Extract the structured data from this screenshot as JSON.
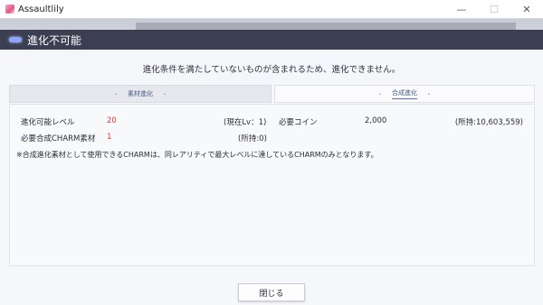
{
  "window": {
    "title": "Assaultlily",
    "minimize_glyph": "—",
    "maximize_glyph": "☐",
    "close_glyph": "✕"
  },
  "dialog": {
    "title": "進化不可能",
    "message": "進化条件を満たしていないものが含まれるため、進化できません。",
    "tabs": [
      {
        "label": "素材進化",
        "active": false
      },
      {
        "label": "合成進化",
        "active": true
      }
    ],
    "tab_dot": "・",
    "info": {
      "level_label": "進化可能レベル",
      "level_value": "20",
      "current_level": "(現在Lv：1)",
      "coin_label": "必要コイン",
      "coin_value": "2,000",
      "coin_owned": "(所持:10,603,559)",
      "charm_label": "必要合成CHARM素材",
      "charm_value": "1",
      "charm_owned": "(所持:0)"
    },
    "note": "※合成進化素材として使用できるCHARMは、同レアリティで最大レベルに達しているCHARMのみとなります。",
    "close_button": "閉じる"
  },
  "colors": {
    "header_bg": "#3b3f51",
    "highlight_red": "#e03a3a",
    "accent_blue": "#5a6cc4"
  }
}
